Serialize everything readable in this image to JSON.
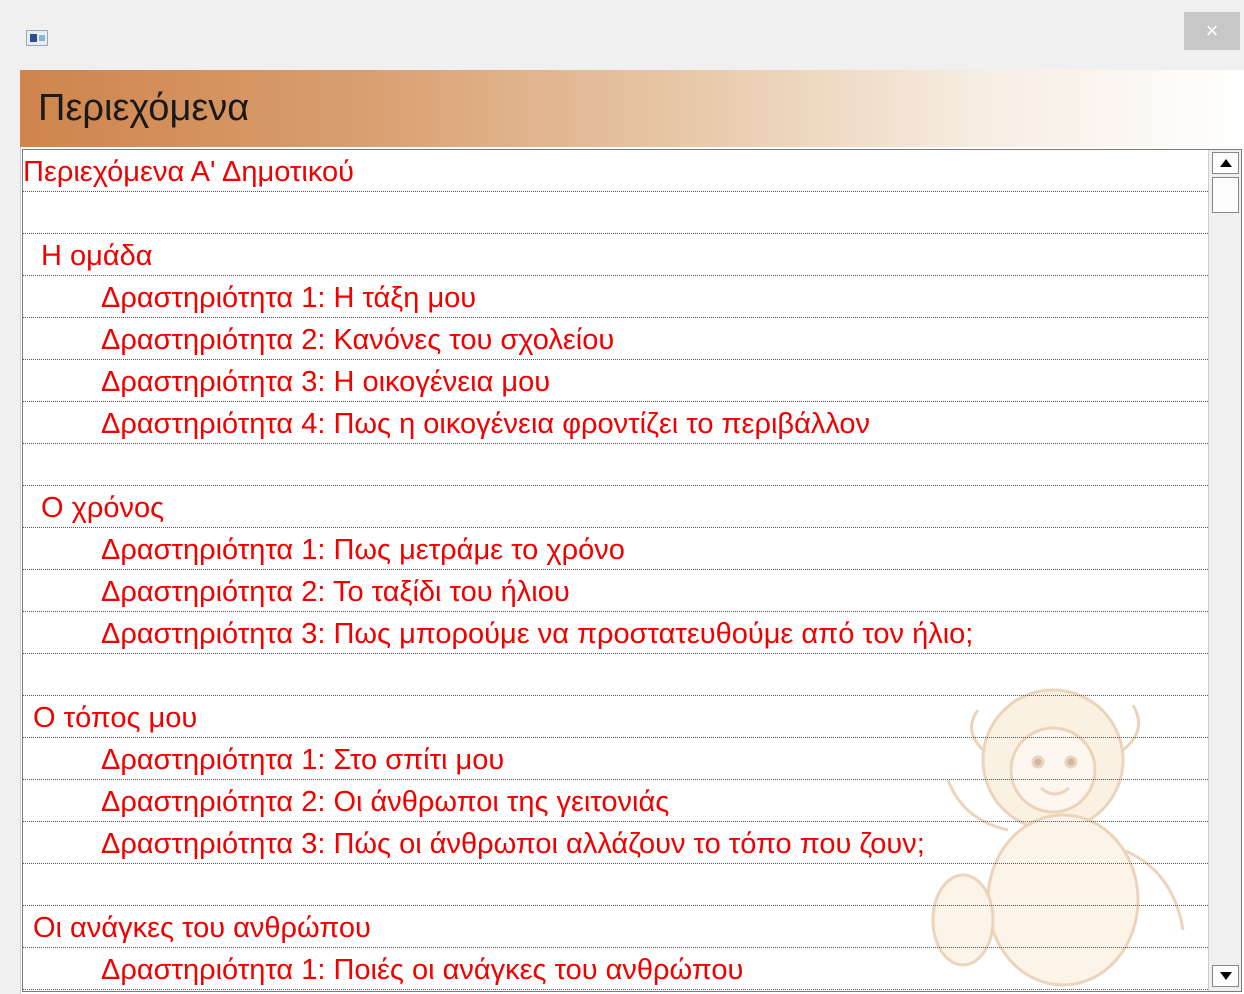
{
  "window": {
    "close_label": "×"
  },
  "header": {
    "title": "Περιεχόμενα"
  },
  "list": {
    "items": [
      {
        "text": "Περιεχόμενα Α' Δημοτικού",
        "level": 0
      },
      {
        "text": "",
        "level": 0
      },
      {
        "text": "Η ομάδα",
        "level": 1
      },
      {
        "text": "Δραστηριότητα 1: Η τάξη μου",
        "level": 2
      },
      {
        "text": "Δραστηριότητα 2: Κανόνες του σχολείου",
        "level": 2
      },
      {
        "text": "Δραστηριότητα 3: Η οικογένεια μου",
        "level": 2
      },
      {
        "text": "Δραστηριότητα 4: Πως η οικογένεια φροντίζει το περιβάλλον",
        "level": 2
      },
      {
        "text": "",
        "level": 0
      },
      {
        "text": "Ο χρόνος",
        "level": 1
      },
      {
        "text": "Δραστηριότητα 1: Πως μετράμε το χρόνο",
        "level": 2
      },
      {
        "text": "Δραστηριότητα 2: Το ταξίδι του ήλιου",
        "level": 2
      },
      {
        "text": "Δραστηριότητα 3: Πως μπορούμε να προστατευθούμε από τον ήλιο;",
        "level": 2
      },
      {
        "text": "",
        "level": 0
      },
      {
        "text": "Ο τόπος μου",
        "level": 3
      },
      {
        "text": "Δραστηριότητα 1: Στο σπίτι μου",
        "level": 2
      },
      {
        "text": "Δραστηριότητα 2: Οι άνθρωποι της γειτονιάς",
        "level": 2
      },
      {
        "text": "Δραστηριότητα 3: Πώς οι άνθρωποι αλλάζουν το τόπο που ζουν;",
        "level": 2
      },
      {
        "text": "",
        "level": 0
      },
      {
        "text": "Οι ανάγκες του ανθρώπου",
        "level": 3
      },
      {
        "text": "Δραστηριότητα 1: Ποιές οι ανάγκες του ανθρώπου",
        "level": 2
      }
    ]
  },
  "icons": {
    "app": "app-window-icon",
    "close": "close-icon",
    "scroll_up": "arrow-up-icon",
    "scroll_down": "arrow-down-icon",
    "watermark": "lion-mascot-watermark"
  },
  "colors": {
    "item_text": "#f20000",
    "header_gradient_start": "#cf844c",
    "header_gradient_end": "#ffffff",
    "close_button": "#c7c7c7"
  }
}
